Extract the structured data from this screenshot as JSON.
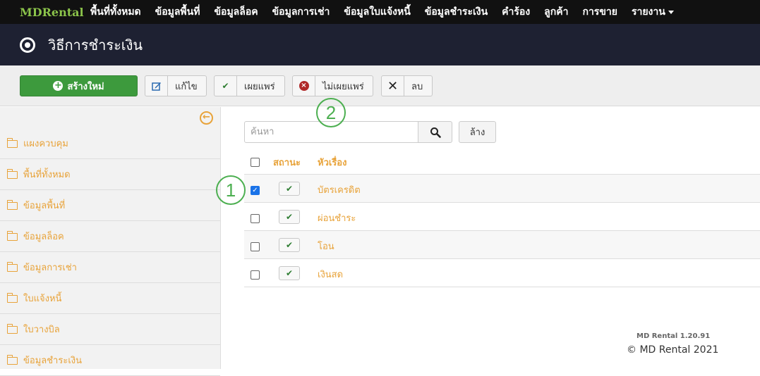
{
  "navbar": {
    "brand": "MDRental",
    "items": [
      "พื้นที่ทั้งหมด",
      "ข้อมูลพื้นที่",
      "ข้อมูลล็อค",
      "ข้อมูลการเช่า",
      "ข้อมูลใบแจ้งหนี้",
      "ข้อมูลชำระเงิน",
      "คำร้อง",
      "ลูกค้า",
      "การขาย",
      "รายงาน"
    ]
  },
  "header": {
    "title": "วิธีการชำระเงิน"
  },
  "toolbar": {
    "new_label": "สร้างใหม่",
    "edit_label": "แก้ไข",
    "publish_label": "เผยแพร่",
    "unpublish_label": "ไม่เผยแพร่",
    "delete_label": "ลบ"
  },
  "sidebar": {
    "items": [
      "แผงควบคุม",
      "พื้นที่ทั้งหมด",
      "ข้อมูลพื้นที่",
      "ข้อมูลล็อค",
      "ข้อมูลการเช่า",
      "ใบแจ้งหนี้",
      "ใบวางบิล",
      "ข้อมูลชำระเงิน"
    ]
  },
  "search": {
    "placeholder": "ค้นหา",
    "clear_label": "ล้าง"
  },
  "table": {
    "headers": {
      "status": "สถานะ",
      "title": "หัวเรื่อง"
    },
    "rows": [
      {
        "title": "บัตรเครดิต",
        "checked": true,
        "published": true
      },
      {
        "title": "ผ่อนชำระ",
        "checked": false,
        "published": true
      },
      {
        "title": "โอน",
        "checked": false,
        "published": true
      },
      {
        "title": "เงินสด",
        "checked": false,
        "published": true
      }
    ]
  },
  "footer": {
    "version": "MD Rental 1.20.91",
    "copyright": "© MD Rental 2021"
  },
  "annotations": {
    "step1": "1",
    "step2": "2"
  },
  "colors": {
    "accent": "#e8a33a",
    "navbar": "#111111",
    "titlebar": "#1e2132",
    "success": "#3d9a3d",
    "annotation": "#4caf50"
  }
}
